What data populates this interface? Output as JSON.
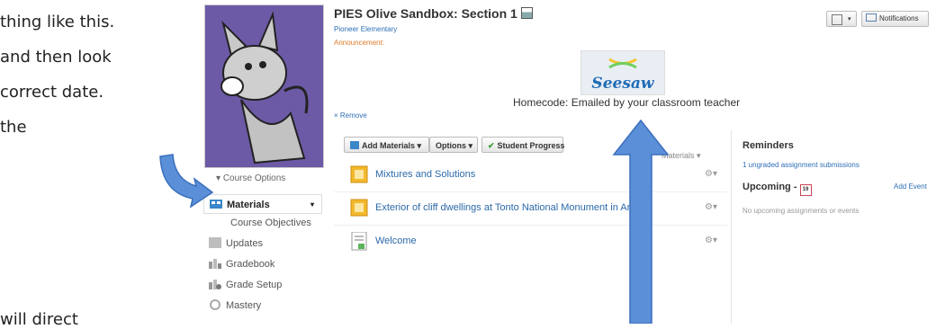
{
  "overlay": {
    "line1": "thing like this.",
    "line2": "and then look",
    "line3": "correct date.",
    "line4": "the",
    "line5": "will direct"
  },
  "sidebar": {
    "course_options": "Course Options",
    "items": [
      {
        "label": "Materials",
        "icon": "materials-icon",
        "active": true
      },
      {
        "label": "Course Objectives",
        "icon": "",
        "sub": true
      },
      {
        "label": "Updates",
        "icon": "updates-icon"
      },
      {
        "label": "Gradebook",
        "icon": "gradebook-icon"
      },
      {
        "label": "Grade Setup",
        "icon": "grade-setup-icon"
      },
      {
        "label": "Mastery",
        "icon": "mastery-icon"
      }
    ]
  },
  "header": {
    "title": "PIES Olive Sandbox: Section 1",
    "subtitle": "Pioneer Elementary",
    "announcement": "Announcement:",
    "notifications": "Notifications"
  },
  "announcement": {
    "logo_text": "Seesaw",
    "homecode": "Homecode:  Emailed by your classroom teacher",
    "remove": "× Remove"
  },
  "toolbar": {
    "add_materials": "Add Materials ▾",
    "options": "Options ▾",
    "student_progress": "Student Progress",
    "materials_filter": "Materials ▾"
  },
  "materials": [
    {
      "title": "Mixtures and Solutions",
      "icon": "folder-icon"
    },
    {
      "title": "Exterior of cliff dwellings at Tonto National Monument in Ariz",
      "icon": "folder-icon"
    },
    {
      "title": "Welcome",
      "icon": "page-icon"
    }
  ],
  "reminders": {
    "title": "Reminders",
    "ungraded": "1 ungraded assignment submissions",
    "upcoming": "Upcoming -",
    "add_event": "Add Event",
    "none": "No upcoming assignments or events"
  },
  "colors": {
    "link": "#2f6fb7",
    "accent": "#e07b2b",
    "arrow": "#5b8fd8"
  }
}
